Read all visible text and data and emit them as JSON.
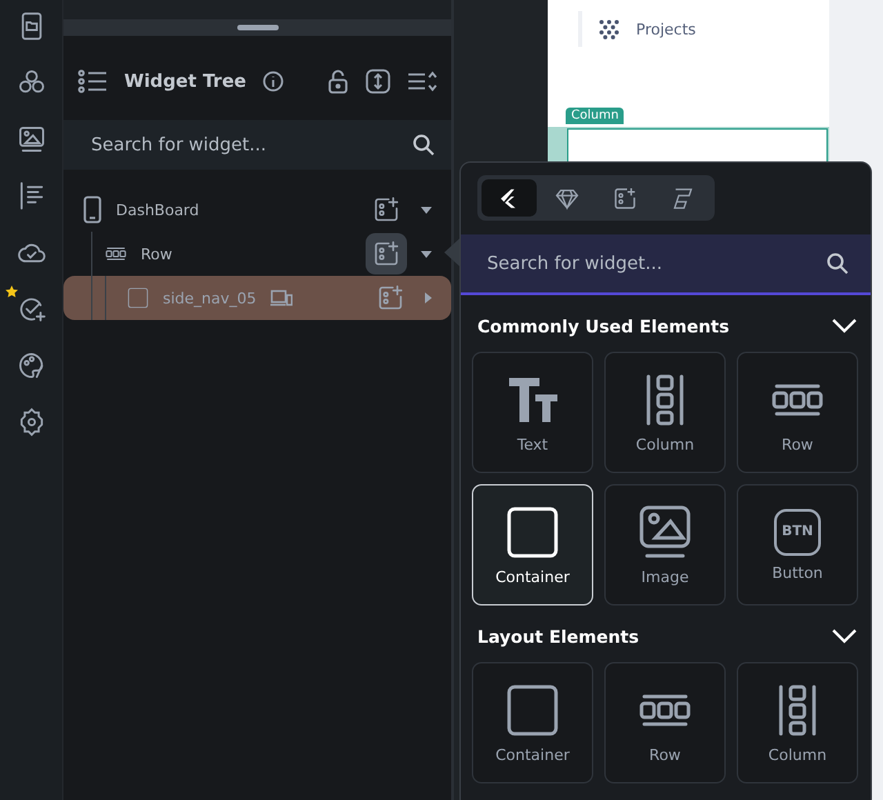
{
  "widget_tree": {
    "title": "Widget Tree",
    "search": {
      "placeholder": "Search for widget..."
    },
    "nodes": [
      {
        "label": "DashBoard",
        "kind": "page",
        "selected": false,
        "expanded": true,
        "add_active": false,
        "children": [
          {
            "label": "Row",
            "kind": "row",
            "selected": false,
            "expanded": true,
            "add_active": true,
            "children": [
              {
                "label": "side_nav_05",
                "kind": "container",
                "selected": true,
                "expanded": false,
                "add_active": false,
                "responsive": true
              }
            ]
          }
        ]
      }
    ]
  },
  "canvas": {
    "nav_item": "Projects",
    "selection_tag": "Column"
  },
  "widget_picker": {
    "tabs": [
      {
        "kind": "flutter",
        "selected": true
      },
      {
        "kind": "gem",
        "selected": false
      },
      {
        "kind": "components",
        "selected": false
      },
      {
        "kind": "library",
        "selected": false
      }
    ],
    "search": {
      "placeholder": "Search for widget..."
    },
    "sections": [
      {
        "title": "Commonly Used Elements",
        "expanded": true,
        "items": [
          {
            "label": "Text",
            "kind": "text",
            "selected": false
          },
          {
            "label": "Column",
            "kind": "column",
            "selected": false
          },
          {
            "label": "Row",
            "kind": "row",
            "selected": false
          },
          {
            "label": "Container",
            "kind": "container",
            "selected": true
          },
          {
            "label": "Image",
            "kind": "image",
            "selected": false
          },
          {
            "label": "Button",
            "kind": "button",
            "glyph": "BTN",
            "selected": false
          }
        ]
      },
      {
        "title": "Layout Elements",
        "expanded": true,
        "items": [
          {
            "label": "Container",
            "kind": "container",
            "selected": false
          },
          {
            "label": "Row",
            "kind": "row",
            "selected": false
          },
          {
            "label": "Column",
            "kind": "column",
            "selected": false
          }
        ]
      }
    ]
  }
}
